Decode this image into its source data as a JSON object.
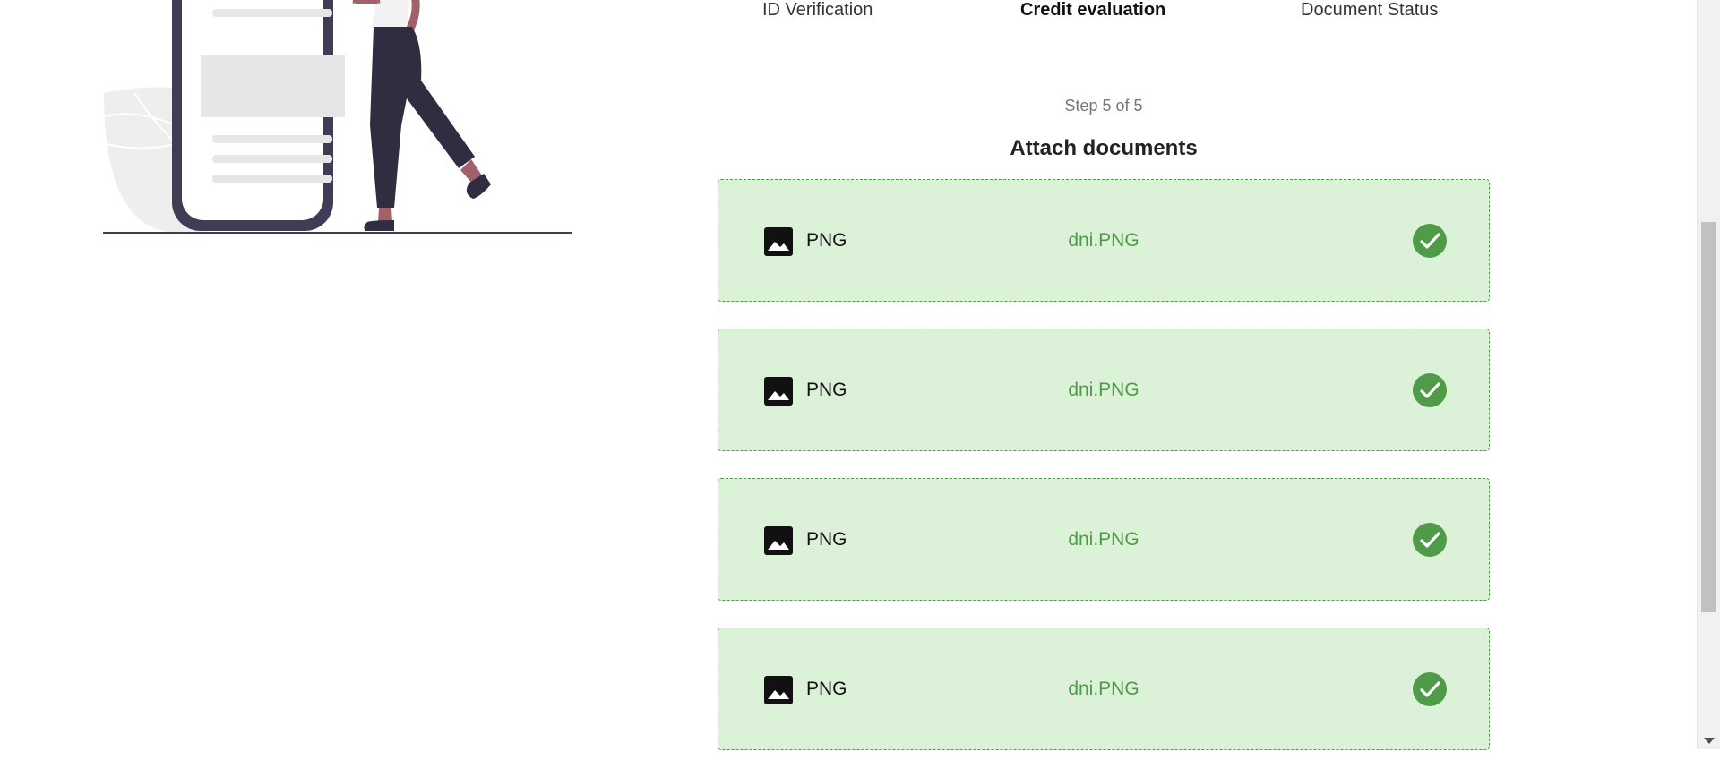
{
  "stepper": {
    "tabs": [
      {
        "label": "ID Verification",
        "active": false
      },
      {
        "label": "Credit evaluation",
        "active": true
      },
      {
        "label": "Document Status",
        "active": false
      }
    ]
  },
  "main": {
    "step_text": "Step 5 of 5",
    "title": "Attach documents",
    "documents": [
      {
        "type": "PNG",
        "file_name": "dni.PNG",
        "status_icon": "check-circle-icon"
      },
      {
        "type": "PNG",
        "file_name": "dni.PNG",
        "status_icon": "check-circle-icon"
      },
      {
        "type": "PNG",
        "file_name": "dni.PNG",
        "status_icon": "check-circle-icon"
      },
      {
        "type": "PNG",
        "file_name": "dni.PNG",
        "status_icon": "check-circle-icon"
      }
    ]
  },
  "colors": {
    "card_background": "#dbf2d8",
    "accent_green": "#4f9b47",
    "phone_frame": "#3f3d56"
  }
}
